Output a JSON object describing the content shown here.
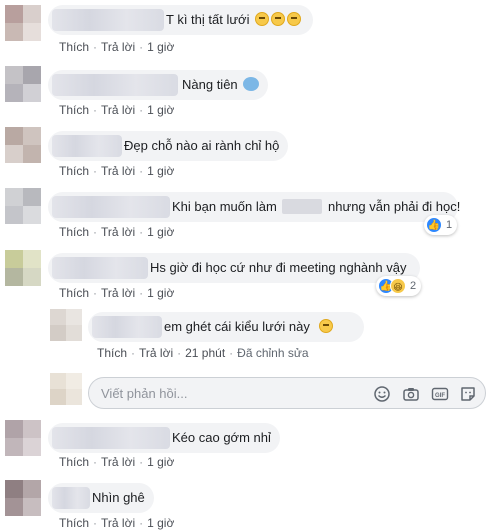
{
  "comments": [
    {
      "text": "T kì thị tất lưới",
      "emoji_count": 3,
      "actions": {
        "like": "Thích",
        "reply": "Trả lời",
        "time": "1 giờ"
      }
    },
    {
      "text": "Nàng tiên",
      "actions": {
        "like": "Thích",
        "reply": "Trả lời",
        "time": "1 giờ"
      }
    },
    {
      "text": "Đẹp chỗ nào ai rành chỉ hộ",
      "actions": {
        "like": "Thích",
        "reply": "Trả lời",
        "time": "1 giờ"
      }
    },
    {
      "text_before": "Khi bạn muốn làm",
      "text_after": "nhưng vẫn phải đi học!",
      "reaction_count": "1",
      "actions": {
        "like": "Thích",
        "reply": "Trả lời",
        "time": "1 giờ"
      }
    },
    {
      "text": "Hs giờ đi học cứ như đi meeting nghành vậy",
      "reaction_count": "2",
      "actions": {
        "like": "Thích",
        "reply": "Trả lời",
        "time": "1 giờ"
      }
    },
    {
      "text": "em ghét cái kiểu lưới này",
      "actions": {
        "like": "Thích",
        "reply": "Trả lời",
        "time": "21 phút",
        "edited": "Đã chỉnh sửa"
      }
    },
    {
      "text": "Kéo cao gớm nhỉ",
      "actions": {
        "like": "Thích",
        "reply": "Trả lời",
        "time": "1 giờ"
      }
    },
    {
      "text": "Nhìn ghê",
      "actions": {
        "like": "Thích",
        "reply": "Trả lời",
        "time": "1 giờ"
      }
    }
  ],
  "reply_box": {
    "placeholder": "Viết phản hồi...",
    "icons": [
      "emoji-icon",
      "camera-icon",
      "gif-icon",
      "sticker-icon"
    ]
  },
  "colors": {
    "like_blue": "#2d88ff",
    "bubble_bg": "#f2f3f5",
    "meta_gray": "#606770"
  }
}
